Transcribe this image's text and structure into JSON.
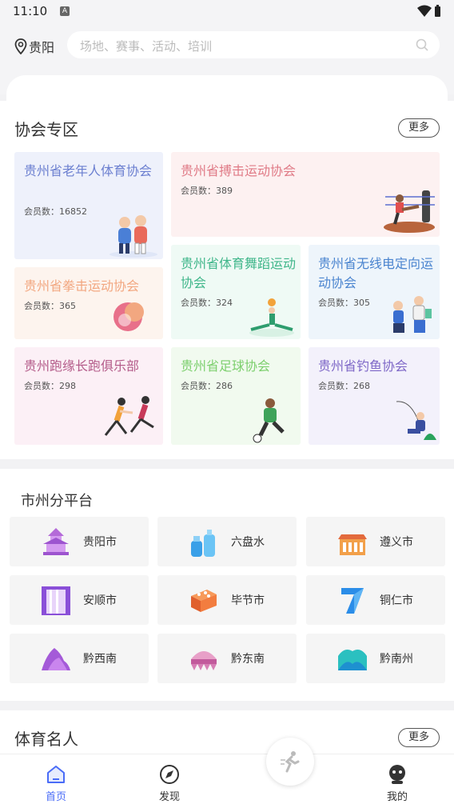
{
  "status": {
    "time": "11:10",
    "notif_glyph": "A"
  },
  "header": {
    "city": "贵阳",
    "search_placeholder": "场地、赛事、活动、培训"
  },
  "associations": {
    "title": "协会专区",
    "more_label": "更多",
    "items": [
      {
        "name": "贵州省老年人体育协会",
        "count": "会员数：16852",
        "color": "#6b7fd0",
        "bg": "#eef1fb"
      },
      {
        "name": "贵州省搏击运动协会",
        "count": "会员数：389",
        "color": "#e07a86",
        "bg": "#fdf1f1"
      },
      {
        "name": "贵州省体育舞蹈运动协会",
        "count": "会员数：324",
        "color": "#3fb68a",
        "bg": "#effaf5"
      },
      {
        "name": "贵州省无线电定向运动协会",
        "count": "会员数：305",
        "color": "#4a84cf",
        "bg": "#eef5fb"
      },
      {
        "name": "贵州省拳击运动协会",
        "count": "会员数：365",
        "color": "#f2a780",
        "bg": "#fdf4ee"
      },
      {
        "name": "贵州跑缘长跑俱乐部",
        "count": "会员数：298",
        "color": "#b45c8a",
        "bg": "#fcf0f6"
      },
      {
        "name": "贵州省足球协会",
        "count": "会员数：286",
        "color": "#7ccf6d",
        "bg": "#f1faef"
      },
      {
        "name": "贵州省钓鱼协会",
        "count": "会员数：268",
        "color": "#7e67c7",
        "bg": "#f3f1fb"
      }
    ]
  },
  "cities": {
    "title": "市州分平台",
    "items": [
      {
        "label": "贵阳市",
        "icon": "pagoda-icon"
      },
      {
        "label": "六盘水",
        "icon": "bottles-icon"
      },
      {
        "label": "遵义市",
        "icon": "building-icon"
      },
      {
        "label": "安顺市",
        "icon": "waterfall-icon"
      },
      {
        "label": "毕节市",
        "icon": "brick-icon"
      },
      {
        "label": "铜仁市",
        "icon": "number-seven-icon"
      },
      {
        "label": "黔西南",
        "icon": "mountain-icon"
      },
      {
        "label": "黔东南",
        "icon": "silver-crown-icon"
      },
      {
        "label": "黔南州",
        "icon": "hills-icon"
      }
    ]
  },
  "stars": {
    "title": "体育名人",
    "more_label": "更多"
  },
  "tabbar": {
    "items": [
      {
        "label": "首页",
        "icon": "home-icon",
        "active": true
      },
      {
        "label": "发现",
        "icon": "compass-icon",
        "active": false
      },
      {
        "label": "我的",
        "icon": "profile-icon",
        "active": false
      }
    ],
    "center_icon": "runner-icon"
  }
}
